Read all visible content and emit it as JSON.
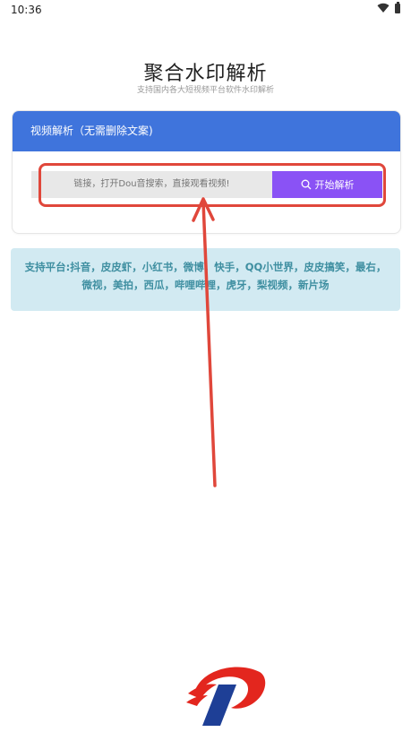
{
  "status_bar": {
    "time": "10:36"
  },
  "header": {
    "title": "聚合水印解析",
    "subtitle": "支持国内各大短视频平台软件水印解析"
  },
  "card": {
    "header_label": "视频解析（无需删除文案)",
    "input_placeholder": "链接，打开Dou音搜索，直接观看视频!",
    "button_label": "开始解析"
  },
  "platforms": {
    "text": "支持平台:抖音，皮皮虾，小红书，微博，快手，QQ小世界，皮皮搞笑，最右，微视，美拍，西瓜，哔哩哔哩，虎牙，梨视频，新片场"
  },
  "colors": {
    "card_header": "#3f74dc",
    "button": "#8a52f5",
    "annotation": "#e0473b",
    "platforms_bg": "#d2eaf2"
  }
}
